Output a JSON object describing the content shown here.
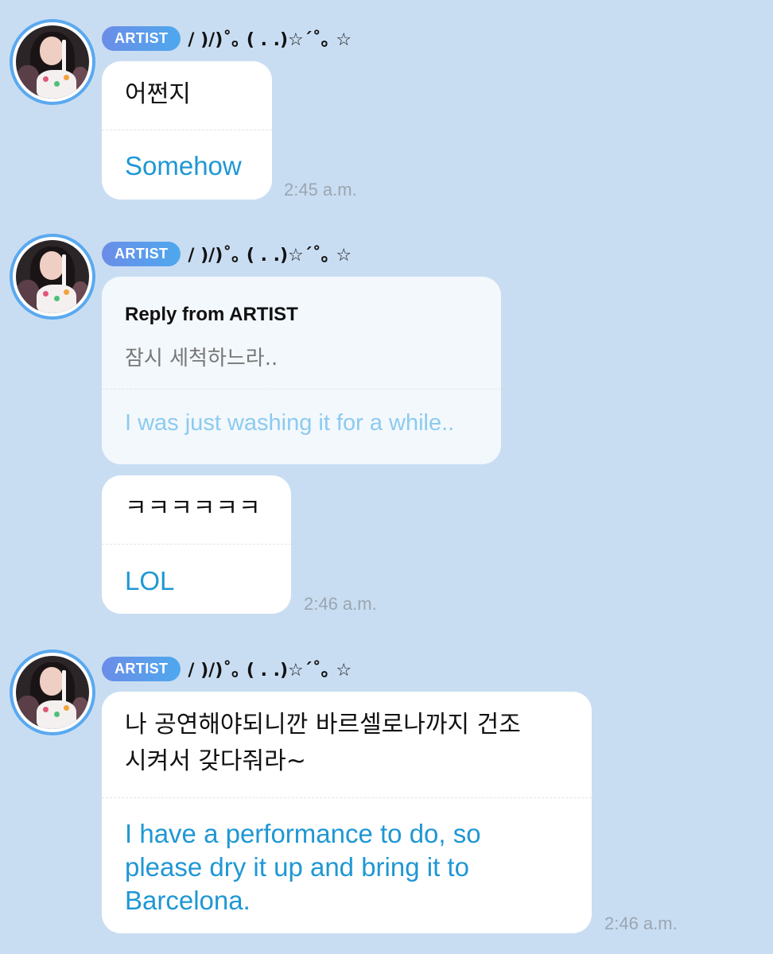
{
  "sender": {
    "badge": "ARTIST",
    "nickname": "/ )/)˚｡ ( . .)☆´˚｡ ☆"
  },
  "messages": [
    {
      "korean": "어쩐지",
      "english": "Somehow",
      "time": "2:45 a.m."
    },
    {
      "reply": {
        "title": "Reply from ARTIST",
        "korean": "잠시 세척하느라..",
        "english": "I was just washing it for a while.."
      },
      "korean": "ㅋㅋㅋㅋㅋㅋ",
      "english": "LOL",
      "time": "2:46 a.m."
    },
    {
      "korean_lines": [
        "나 공연해야되니깐 바르셀로나까지 건조",
        "시켜서 갖다줘라~"
      ],
      "english_lines": [
        "I have a performance to do, so",
        "please dry it up and bring it to",
        "Barcelona."
      ],
      "time": "2:46 a.m."
    }
  ],
  "colors": {
    "background": "#c9ddf2",
    "bubble": "#ffffff",
    "reply_bubble": "#f3f8fd",
    "translation_text": "#1f97d4",
    "avatar_ring": "#5aa9ef",
    "badge_gradient": [
      "#6b8de8",
      "#4ea8ee"
    ]
  }
}
